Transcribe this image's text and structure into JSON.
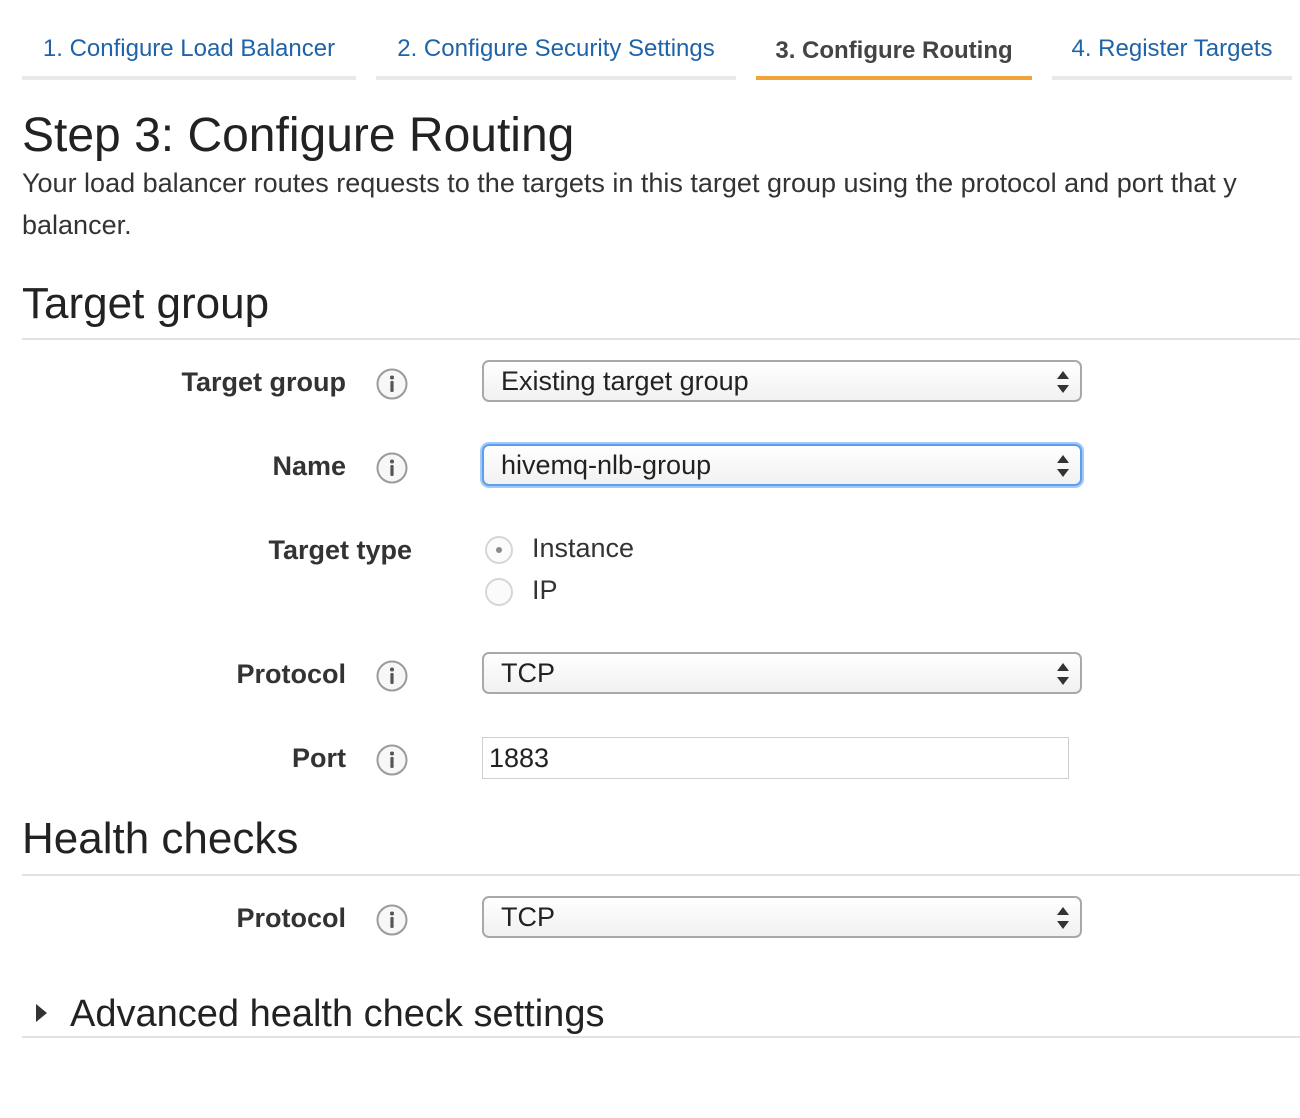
{
  "wizard": {
    "tabs": [
      {
        "label": "1. Configure Load Balancer",
        "active": false
      },
      {
        "label": "2. Configure Security Settings",
        "active": false
      },
      {
        "label": "3. Configure Routing",
        "active": true
      },
      {
        "label": "4. Register Targets",
        "active": false
      }
    ]
  },
  "page": {
    "title": "Step 3: Configure Routing",
    "description_line1": "Your load balancer routes requests to the targets in this target group using the protocol and port that y",
    "description_line2": "balancer."
  },
  "target_group_section": {
    "title": "Target group",
    "fields": {
      "target_group": {
        "label": "Target group",
        "value": "Existing target group"
      },
      "name": {
        "label": "Name",
        "value": "hivemq-nlb-group"
      },
      "target_type": {
        "label": "Target type",
        "options": [
          "Instance",
          "IP"
        ],
        "selected": "Instance"
      },
      "protocol": {
        "label": "Protocol",
        "value": "TCP"
      },
      "port": {
        "label": "Port",
        "value": "1883"
      }
    }
  },
  "health_checks_section": {
    "title": "Health checks",
    "protocol": {
      "label": "Protocol",
      "value": "TCP"
    },
    "advanced_label": "Advanced health check settings"
  },
  "colors": {
    "link": "#1f63a8",
    "active_tab_underline": "#f0a33a",
    "focus_ring": "#5b9ef0"
  },
  "icons": {
    "info": "info-icon",
    "select_arrows": "updown-arrows-icon",
    "expand": "caret-right-icon"
  }
}
